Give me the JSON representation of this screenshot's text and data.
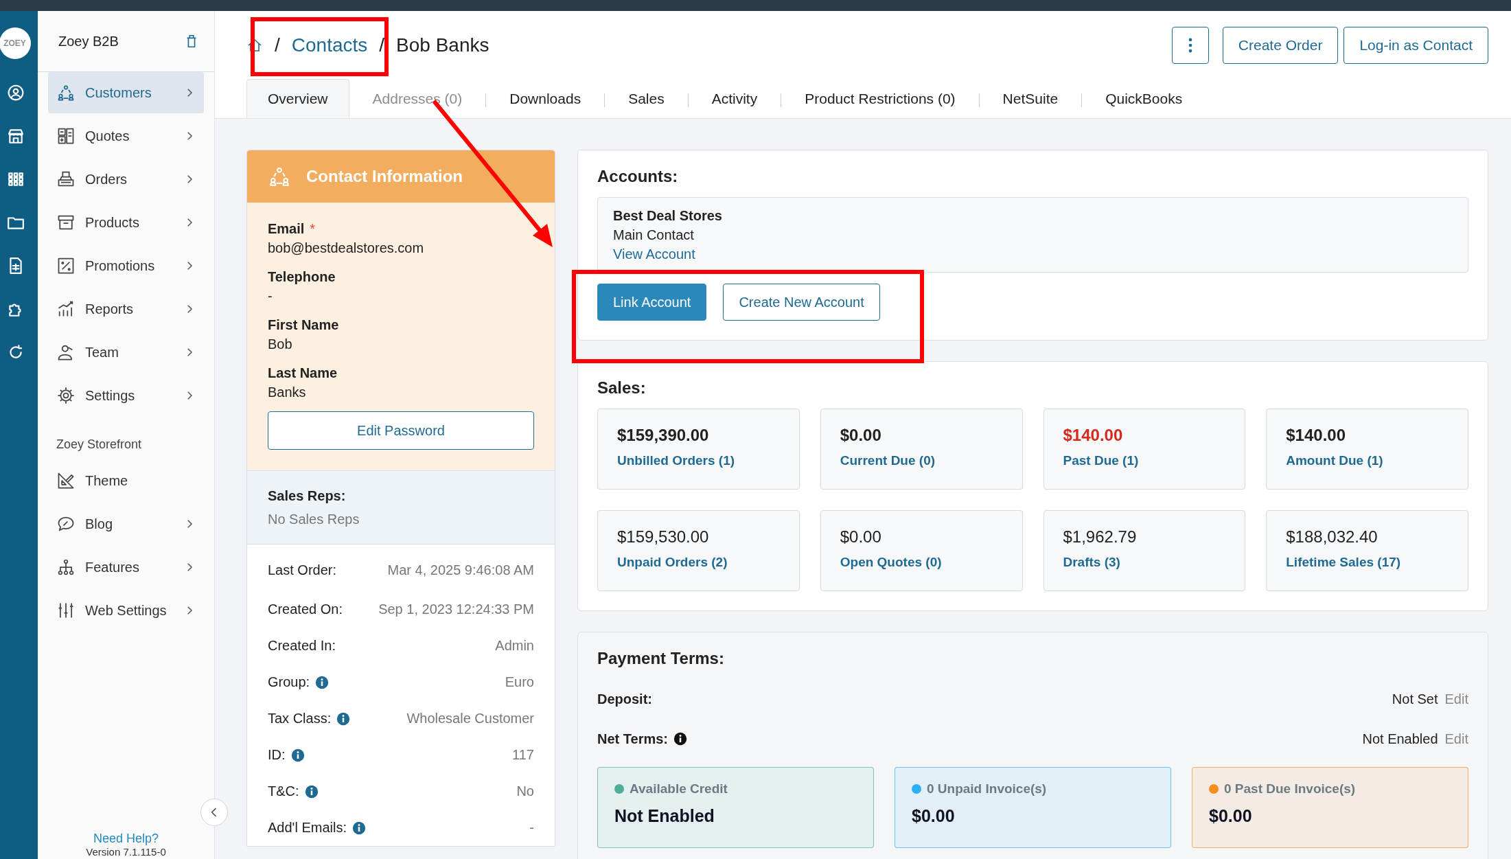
{
  "logo": "ZOEY",
  "sidebar": {
    "title": "Zoey B2B",
    "items": [
      {
        "label": "Customers",
        "selected": true,
        "expandable": true
      },
      {
        "label": "Quotes",
        "selected": false,
        "expandable": true
      },
      {
        "label": "Orders",
        "selected": false,
        "expandable": true
      },
      {
        "label": "Products",
        "selected": false,
        "expandable": true
      },
      {
        "label": "Promotions",
        "selected": false,
        "expandable": true
      },
      {
        "label": "Reports",
        "selected": false,
        "expandable": true
      },
      {
        "label": "Team",
        "selected": false,
        "expandable": true
      },
      {
        "label": "Settings",
        "selected": false,
        "expandable": true
      }
    ],
    "section_label": "Zoey Storefront",
    "section_items": [
      {
        "label": "Theme",
        "selected": false,
        "expandable": false
      },
      {
        "label": "Blog",
        "selected": false,
        "expandable": true
      },
      {
        "label": "Features",
        "selected": false,
        "expandable": true
      },
      {
        "label": "Web Settings",
        "selected": false,
        "expandable": true
      }
    ],
    "help_link": "Need Help?",
    "version": "Version 7.1.115-0"
  },
  "breadcrumb": [
    {
      "separator": "/",
      "label": "Contacts",
      "link": true
    },
    {
      "separator": "/",
      "label": "Bob Banks",
      "link": false
    }
  ],
  "header_buttons": [
    "Create Order",
    "Log-in as Contact"
  ],
  "tabs": [
    {
      "label": "Overview",
      "selected": true,
      "disabled": false
    },
    {
      "label": "Addresses (0)",
      "selected": false,
      "disabled": true
    },
    {
      "label": "Downloads",
      "selected": false,
      "disabled": false
    },
    {
      "label": "Sales",
      "selected": false,
      "disabled": false
    },
    {
      "label": "Activity",
      "selected": false,
      "disabled": false
    },
    {
      "label": "Product Restrictions (0)",
      "selected": false,
      "disabled": false
    },
    {
      "label": "NetSuite",
      "selected": false,
      "disabled": false
    },
    {
      "label": "QuickBooks",
      "selected": false,
      "disabled": false
    }
  ],
  "contact_card": {
    "title": "Contact Information",
    "fields": [
      {
        "label": "Email",
        "value": "bob@bestdealstores.com",
        "required_mark": "*"
      },
      {
        "label": "Telephone",
        "value": "-"
      },
      {
        "label": "First Name",
        "value": "Bob"
      },
      {
        "label": "Last Name",
        "value": "Banks"
      }
    ],
    "button": "Edit Password",
    "sales_reps": {
      "label": "Sales Reps:",
      "value": "No Sales Reps"
    },
    "details": [
      {
        "label": "Last Order:",
        "value": "Mar 4, 2025 9:46:08 AM",
        "info": false
      },
      {
        "label": "Created On:",
        "value": "Sep 1, 2023 12:24:33 PM",
        "info": false
      },
      {
        "label": "Created In:",
        "value": "Admin",
        "info": false
      },
      {
        "label": "Group:",
        "value": "Euro",
        "info": true
      },
      {
        "label": "Tax Class:",
        "value": "Wholesale Customer",
        "info": true
      },
      {
        "label": "ID:",
        "value": "117",
        "info": true
      },
      {
        "label": "T&C:",
        "value": "No",
        "info": true
      },
      {
        "label": "Add'l Emails:",
        "value": "-",
        "info": true
      }
    ]
  },
  "accounts": {
    "title": "Accounts:",
    "items": [
      {
        "name": "Best Deal Stores",
        "role": "Main Contact",
        "link": "View Account"
      }
    ],
    "buttons": [
      {
        "label": "Link Account",
        "primary": true
      },
      {
        "label": "Create New Account",
        "primary": false
      }
    ]
  },
  "sales": {
    "title": "Sales:",
    "tiles": [
      {
        "amount": "$159,390.00",
        "label": "Unbilled Orders (1)",
        "kind": "bold"
      },
      {
        "amount": "$0.00",
        "label": "Current Due (0)",
        "kind": "bold"
      },
      {
        "amount": "$140.00",
        "label": "Past Due (1)",
        "kind": "alert"
      },
      {
        "amount": "$140.00",
        "label": "Amount Due (1)",
        "kind": "bold"
      },
      {
        "amount": "$159,530.00",
        "label": "Unpaid Orders (2)",
        "kind": "plain"
      },
      {
        "amount": "$0.00",
        "label": "Open Quotes (0)",
        "kind": "plain"
      },
      {
        "amount": "$1,962.79",
        "label": "Drafts (3)",
        "kind": "plain"
      },
      {
        "amount": "$188,032.40",
        "label": "Lifetime Sales (17)",
        "kind": "plain"
      }
    ]
  },
  "payment_terms": {
    "title": "Payment Terms:",
    "rows": [
      {
        "label": "Deposit:",
        "value": "Not Set",
        "action": "Edit",
        "info": false
      },
      {
        "label": "Net Terms:",
        "value": "Not Enabled",
        "action": "Edit",
        "info": true
      }
    ],
    "summaries": [
      {
        "label": "Available Credit",
        "value": "Not Enabled",
        "color": "#4caf96"
      },
      {
        "label": "0 Unpaid Invoice(s)",
        "value": "$0.00",
        "color": "#2bb0f0"
      },
      {
        "label": "0 Past Due Invoice(s)",
        "value": "$0.00",
        "color": "#f5901e"
      }
    ]
  }
}
